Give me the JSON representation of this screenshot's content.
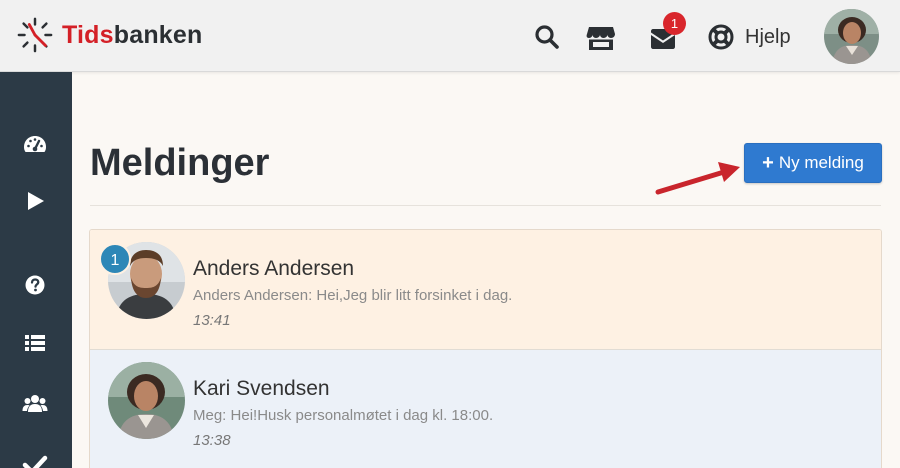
{
  "app": {
    "logo_prefix": "Tids",
    "logo_suffix": "banken"
  },
  "header": {
    "help_label": "Hjelp",
    "mail_badge_count": "1",
    "icons": [
      "search-icon",
      "store-icon",
      "envelope-icon",
      "life-ring-icon",
      "user-avatar"
    ]
  },
  "sidebar": {
    "items": [
      {
        "icon": "dashboard-icon"
      },
      {
        "icon": "play-icon"
      },
      {
        "icon": "question-circle-icon"
      },
      {
        "icon": "list-icon"
      },
      {
        "icon": "users-icon"
      },
      {
        "icon": "check-icon"
      }
    ]
  },
  "main": {
    "title": "Meldinger",
    "new_message_label": "Ny melding"
  },
  "messages": [
    {
      "name": "Anders Andersen",
      "preview": "Anders Andersen: Hei,Jeg blir litt forsinket i dag.",
      "time": "13:41",
      "unread_count": "1",
      "state": "unread"
    },
    {
      "name": "Kari Svendsen",
      "preview": "Meg: Hei!Husk personalmøtet i dag kl. 18:00.",
      "time": "13:38",
      "state": "read"
    }
  ],
  "colors": {
    "sidebar": "#2c3a46",
    "primary_button": "#2f7ad0",
    "badge_red": "#d9262c",
    "badge_blue": "#2d87b7",
    "unread_bg": "#fef1e3",
    "read_bg": "#ecf1f8",
    "arrow": "#c9252c"
  }
}
